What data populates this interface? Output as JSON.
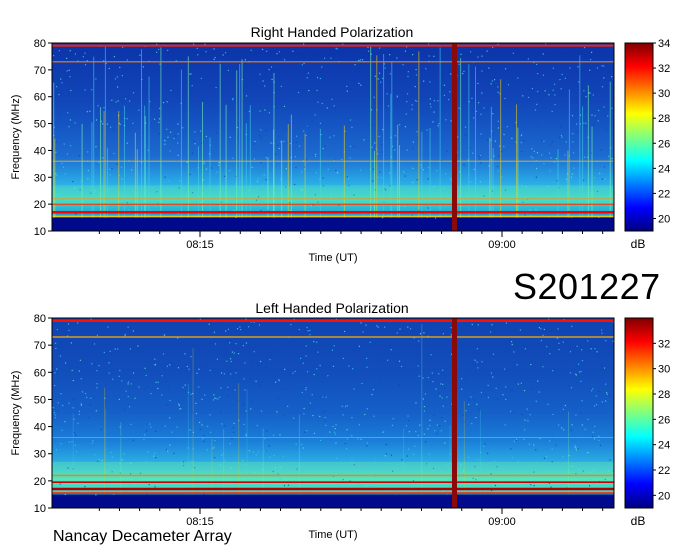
{
  "observation_id": "S201227",
  "instrument": "Nancay Decameter Array",
  "colors": {
    "colormap": [
      "#00007f",
      "#0000ff",
      "#007fff",
      "#00ffff",
      "#7fff7f",
      "#ffff00",
      "#ff7f00",
      "#ff0000",
      "#7f0000"
    ],
    "background": "#00107a"
  },
  "chart_data": [
    {
      "type": "heatmap",
      "title": "Right Handed Polarization",
      "xlabel": "Time (UT)",
      "ylabel": "Frequency (MHz)",
      "x_ticks": [
        "08:15",
        "09:00"
      ],
      "y_ticks": [
        10,
        20,
        30,
        40,
        50,
        60,
        70,
        80
      ],
      "ylim": [
        10,
        80
      ],
      "colorbar": {
        "label": "dB",
        "ticks": [
          20,
          22,
          24,
          26,
          28,
          30,
          32,
          34
        ],
        "range": [
          19,
          34
        ]
      },
      "features": [
        "strong interference lines near 16-22 MHz",
        "horizontal line at ~73 MHz",
        "vertical burst near 08:52 UT"
      ]
    },
    {
      "type": "heatmap",
      "title": "Left Handed Polarization",
      "xlabel": "Time (UT)",
      "ylabel": "Frequency (MHz)",
      "x_ticks": [
        "08:15",
        "09:00"
      ],
      "y_ticks": [
        10,
        20,
        30,
        40,
        50,
        60,
        70,
        80
      ],
      "ylim": [
        10,
        80
      ],
      "colorbar": {
        "label": "dB",
        "ticks": [
          20,
          22,
          24,
          26,
          28,
          30,
          32
        ],
        "range": [
          19,
          34
        ]
      },
      "features": [
        "strong interference lines near 16-22 MHz",
        "horizontal line at ~73 MHz",
        "vertical burst near 08:52 UT"
      ]
    }
  ]
}
